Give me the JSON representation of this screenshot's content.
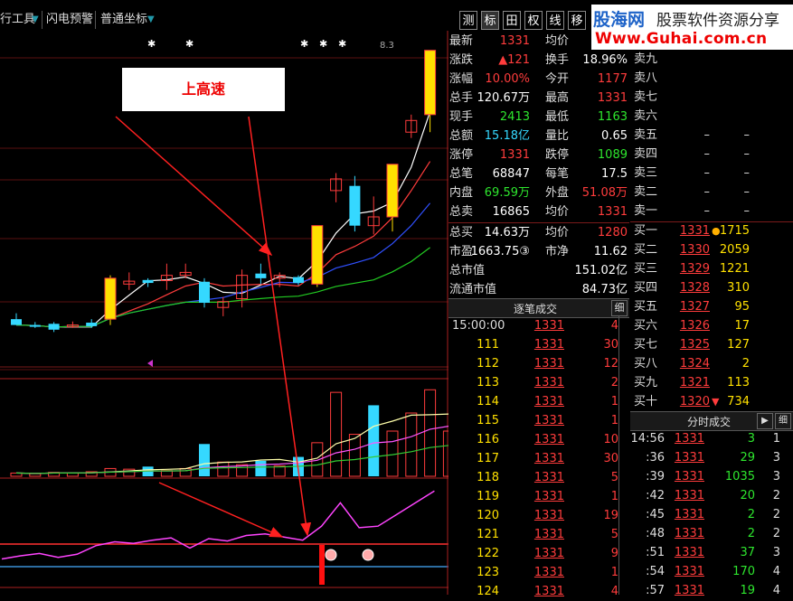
{
  "toolbar": {
    "items": [
      "行工具",
      "闪电预警",
      "普通坐标"
    ],
    "tabs": [
      "测",
      "标",
      "田",
      "权",
      "线",
      "移"
    ],
    "active_tab_index": 1
  },
  "banner": {
    "line1_a": "股海网",
    "line1_b": "股票软件资源分享",
    "line2": "Www.Guhai.com.cn"
  },
  "chart": {
    "callout": "上高速",
    "top_label": "8.3",
    "candles": [
      {
        "o": 7.0,
        "c": 6.9,
        "h": 7.1,
        "l": 6.9,
        "col": "cyan"
      },
      {
        "o": 6.9,
        "c": 6.88,
        "h": 6.95,
        "l": 6.85,
        "col": "cyan"
      },
      {
        "o": 6.92,
        "c": 6.82,
        "h": 6.95,
        "l": 6.78,
        "col": "cyan"
      },
      {
        "o": 6.88,
        "c": 6.9,
        "h": 6.96,
        "l": 6.85,
        "col": "red"
      },
      {
        "o": 6.94,
        "c": 6.88,
        "h": 7.0,
        "l": 6.85,
        "col": "cyan"
      },
      {
        "o": 7.0,
        "c": 7.7,
        "h": 7.75,
        "l": 6.9,
        "col": "yel"
      },
      {
        "o": 7.6,
        "c": 7.65,
        "h": 7.8,
        "l": 7.5,
        "col": "red"
      },
      {
        "o": 7.67,
        "c": 7.62,
        "h": 7.7,
        "l": 7.55,
        "col": "cyan"
      },
      {
        "o": 7.66,
        "c": 7.75,
        "h": 7.95,
        "l": 7.5,
        "col": "red"
      },
      {
        "o": 7.75,
        "c": 7.8,
        "h": 7.95,
        "l": 7.7,
        "col": "red"
      },
      {
        "o": 7.64,
        "c": 7.28,
        "h": 7.7,
        "l": 7.2,
        "col": "cyan"
      },
      {
        "o": 7.2,
        "c": 7.3,
        "h": 7.38,
        "l": 7.05,
        "col": "red"
      },
      {
        "o": 7.35,
        "c": 7.75,
        "h": 7.85,
        "l": 7.2,
        "col": "red"
      },
      {
        "o": 7.78,
        "c": 7.7,
        "h": 7.95,
        "l": 7.6,
        "col": "cyan"
      },
      {
        "o": 7.7,
        "c": 7.75,
        "h": 7.8,
        "l": 7.55,
        "col": "red"
      },
      {
        "o": 7.72,
        "c": 7.62,
        "h": 7.75,
        "l": 7.58,
        "col": "cyan"
      },
      {
        "o": 7.6,
        "c": 8.6,
        "h": 8.6,
        "l": 7.55,
        "col": "yel"
      },
      {
        "o": 9.4,
        "c": 9.2,
        "h": 9.5,
        "l": 9.0,
        "col": "red"
      },
      {
        "o": 9.28,
        "c": 8.6,
        "h": 9.45,
        "l": 8.5,
        "col": "cyan"
      },
      {
        "o": 8.6,
        "c": 8.75,
        "h": 9.1,
        "l": 8.45,
        "col": "red"
      },
      {
        "o": 8.75,
        "c": 9.65,
        "h": 9.65,
        "l": 8.5,
        "col": "yel"
      },
      {
        "o": 10.2,
        "c": 10.4,
        "h": 10.5,
        "l": 10.1,
        "col": "red"
      },
      {
        "o": 10.5,
        "c": 11.6,
        "h": 11.6,
        "l": 10.2,
        "col": "yel"
      }
    ],
    "price_min": 6.6,
    "price_max": 11.75,
    "volumes": [
      0.5,
      0.4,
      0.6,
      0.5,
      0.7,
      1.2,
      1.1,
      1.5,
      0.9,
      1.2,
      5.0,
      2.2,
      1.8,
      2.4,
      1.6,
      3.0,
      5.2,
      13.0,
      6.5,
      11.0,
      7.0,
      9.8,
      13.4,
      7.0
    ],
    "vol_colors": [
      "red",
      "red",
      "red",
      "red",
      "red",
      "red",
      "red",
      "cyan",
      "red",
      "red",
      "cyan",
      "red",
      "red",
      "cyan",
      "red",
      "cyan",
      "red",
      "red",
      "red",
      "cyan",
      "red",
      "red",
      "red",
      "red"
    ],
    "indicator": [
      0.18,
      0.22,
      0.25,
      0.2,
      0.24,
      0.35,
      0.4,
      0.38,
      0.42,
      0.45,
      0.32,
      0.44,
      0.41,
      0.48,
      0.5,
      0.46,
      0.42,
      0.6,
      0.9,
      0.58,
      0.6,
      0.75,
      0.9,
      1.05
    ],
    "smiley": "☺"
  },
  "quote": {
    "rows": [
      {
        "l": "最新",
        "v": "1331",
        "vc": "red",
        "l2": "均价",
        "v2": "",
        "v2c": "red"
      },
      {
        "l": "涨跌",
        "v": "▲121",
        "vc": "red",
        "l2": "换手",
        "v2": "18.96%",
        "v2c": "wht"
      },
      {
        "l": "涨幅",
        "v": "10.00%",
        "vc": "red",
        "l2": "今开",
        "v2": "1177",
        "v2c": "red"
      },
      {
        "l": "总手",
        "v": "120.67万",
        "vc": "wht",
        "l2": "最高",
        "v2": "1331",
        "v2c": "red"
      },
      {
        "l": "现手",
        "v": "2413",
        "vc": "grn",
        "l2": "最低",
        "v2": "1163",
        "v2c": "grn"
      },
      {
        "l": "总额",
        "v": "15.18亿",
        "vc": "cyan",
        "l2": "量比",
        "v2": "0.65",
        "v2c": "wht"
      },
      {
        "l": "涨停",
        "v": "1331",
        "vc": "red",
        "l2": "跌停",
        "v2": "1089",
        "v2c": "grn"
      },
      {
        "l": "总笔",
        "v": "68847",
        "vc": "wht",
        "l2": "每笔",
        "v2": "17.5",
        "v2c": "wht"
      },
      {
        "l": "内盘",
        "v": "69.59万",
        "vc": "grn",
        "l2": "外盘",
        "v2": "51.08万",
        "v2c": "red"
      },
      {
        "l": "总卖",
        "v": "16865",
        "vc": "wht",
        "l2": "均价",
        "v2": "1331",
        "v2c": "red"
      },
      {
        "l": "总买",
        "v": "14.63万",
        "vc": "wht",
        "l2": "均价",
        "v2": "1280",
        "v2c": "red"
      },
      {
        "l": "市盈",
        "v": "1663.75③",
        "vc": "wht",
        "l2": "市净",
        "v2": "11.62",
        "v2c": "wht"
      },
      {
        "l": "总市值",
        "v": "",
        "vc": "wht",
        "l2": "",
        "v2": "151.02亿",
        "v2c": "wht"
      },
      {
        "l": "流通市值",
        "v": "",
        "vc": "wht",
        "l2": "",
        "v2": "84.73亿",
        "v2c": "wht"
      }
    ]
  },
  "book": {
    "sells": [
      {
        "l": "卖九",
        "p": "",
        "v": ""
      },
      {
        "l": "卖八",
        "p": "",
        "v": ""
      },
      {
        "l": "卖七",
        "p": "",
        "v": ""
      },
      {
        "l": "卖六",
        "p": "",
        "v": ""
      },
      {
        "l": "卖五",
        "p": "–",
        "v": "–"
      },
      {
        "l": "卖四",
        "p": "–",
        "v": "–"
      },
      {
        "l": "卖三",
        "p": "–",
        "v": "–"
      },
      {
        "l": "卖二",
        "p": "–",
        "v": "–"
      },
      {
        "l": "卖一",
        "p": "–",
        "v": "–"
      }
    ],
    "buys": [
      {
        "l": "买一",
        "p": "1331",
        "v": "1715",
        "mark": "●"
      },
      {
        "l": "买二",
        "p": "1330",
        "v": "2059",
        "mark": ""
      },
      {
        "l": "买三",
        "p": "1329",
        "v": "1221",
        "mark": ""
      },
      {
        "l": "买四",
        "p": "1328",
        "v": "310",
        "mark": ""
      },
      {
        "l": "买五",
        "p": "1327",
        "v": "95",
        "mark": ""
      },
      {
        "l": "买六",
        "p": "1326",
        "v": "17",
        "mark": ""
      },
      {
        "l": "买七",
        "p": "1325",
        "v": "127",
        "mark": ""
      },
      {
        "l": "买八",
        "p": "1324",
        "v": "2",
        "mark": ""
      },
      {
        "l": "买九",
        "p": "1321",
        "v": "113",
        "mark": ""
      },
      {
        "l": "买十",
        "p": "1320",
        "v": "734",
        "mark": "▼"
      }
    ]
  },
  "ticks": {
    "title": "逐笔成交",
    "btn": "细",
    "rows": [
      {
        "t": "15:00:00",
        "p": "1331",
        "v": "4",
        "vc": "red"
      },
      {
        "t": "111",
        "p": "1331",
        "v": "30",
        "vc": "red"
      },
      {
        "t": "112",
        "p": "1331",
        "v": "12",
        "vc": "red"
      },
      {
        "t": "113",
        "p": "1331",
        "v": "2",
        "vc": "red"
      },
      {
        "t": "114",
        "p": "1331",
        "v": "1",
        "vc": "red"
      },
      {
        "t": "115",
        "p": "1331",
        "v": "1",
        "vc": "red"
      },
      {
        "t": "116",
        "p": "1331",
        "v": "10",
        "vc": "red"
      },
      {
        "t": "117",
        "p": "1331",
        "v": "30",
        "vc": "red"
      },
      {
        "t": "118",
        "p": "1331",
        "v": "5",
        "vc": "red"
      },
      {
        "t": "119",
        "p": "1331",
        "v": "1",
        "vc": "red"
      },
      {
        "t": "120",
        "p": "1331",
        "v": "19",
        "vc": "red"
      },
      {
        "t": "121",
        "p": "1331",
        "v": "5",
        "vc": "red"
      },
      {
        "t": "122",
        "p": "1331",
        "v": "9",
        "vc": "red"
      },
      {
        "t": "123",
        "p": "1331",
        "v": "1",
        "vc": "red"
      },
      {
        "t": "124",
        "p": "1331",
        "v": "4",
        "vc": "red"
      }
    ]
  },
  "minutes": {
    "title": "分时成交",
    "btn": "▶",
    "btn2": "细",
    "rows": [
      {
        "t": "14:56",
        "p": "1331",
        "v": "3",
        "vc": "grn",
        "c": "1"
      },
      {
        "t": ":36",
        "p": "1331",
        "v": "29",
        "vc": "grn",
        "c": "3"
      },
      {
        "t": ":39",
        "p": "1331",
        "v": "1035",
        "vc": "grn",
        "c": "3"
      },
      {
        "t": ":42",
        "p": "1331",
        "v": "20",
        "vc": "grn",
        "c": "2"
      },
      {
        "t": ":45",
        "p": "1331",
        "v": "2",
        "vc": "grn",
        "c": "2"
      },
      {
        "t": ":48",
        "p": "1331",
        "v": "2",
        "vc": "grn",
        "c": "2"
      },
      {
        "t": ":51",
        "p": "1331",
        "v": "37",
        "vc": "grn",
        "c": "3"
      },
      {
        "t": ":54",
        "p": "1331",
        "v": "170",
        "vc": "grn",
        "c": "4"
      },
      {
        "t": ":57",
        "p": "1331",
        "v": "19",
        "vc": "grn",
        "c": "4"
      }
    ]
  }
}
